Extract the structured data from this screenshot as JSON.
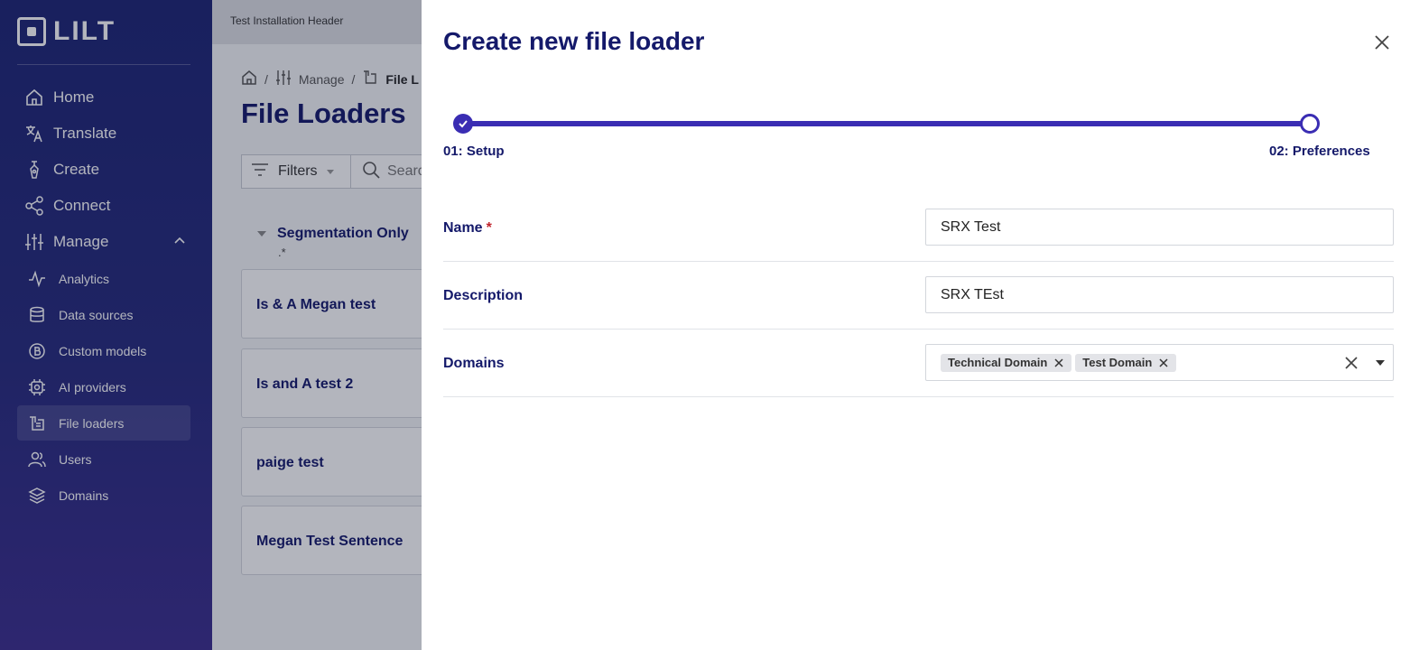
{
  "sidebar": {
    "logo_text": "LILT",
    "main_items": [
      {
        "label": "Home",
        "icon": "home-icon"
      },
      {
        "label": "Translate",
        "icon": "translate-icon"
      },
      {
        "label": "Create",
        "icon": "pen-icon"
      },
      {
        "label": "Connect",
        "icon": "share-icon"
      },
      {
        "label": "Manage",
        "icon": "sliders-icon"
      }
    ],
    "sub_items": [
      {
        "label": "Analytics",
        "icon": "pulse-icon"
      },
      {
        "label": "Data sources",
        "icon": "database-icon"
      },
      {
        "label": "Custom models",
        "icon": "bitcoin-icon"
      },
      {
        "label": "AI providers",
        "icon": "chip-icon"
      },
      {
        "label": "File loaders",
        "icon": "file-loader-icon"
      },
      {
        "label": "Users",
        "icon": "users-icon"
      },
      {
        "label": "Domains",
        "icon": "layers-icon"
      }
    ],
    "active": "File loaders"
  },
  "header": {
    "installation": "Test Installation Header"
  },
  "breadcrumb": {
    "manage": "Manage",
    "current": "File L"
  },
  "page": {
    "title": "File Loaders",
    "filters_label": "Filters",
    "search_placeholder": "Searc",
    "group": {
      "title": "Segmentation Only",
      "subtitle": ".*"
    },
    "cards": [
      "Is & A Megan test",
      "Is and A test 2",
      "paige test",
      "Megan Test Sentence"
    ]
  },
  "drawer": {
    "title": "Create new file loader",
    "steps": [
      "01: Setup",
      "02: Preferences"
    ],
    "fields": {
      "name": {
        "label": "Name",
        "required_mark": "*",
        "value": "SRX Test"
      },
      "description": {
        "label": "Description",
        "value": "SRX TEst"
      },
      "domains": {
        "label": "Domains",
        "chips": [
          "Technical Domain",
          "Test Domain"
        ]
      }
    }
  },
  "colors": {
    "accent": "#3a2db3",
    "navy": "#14196a",
    "required": "#c0242c"
  }
}
